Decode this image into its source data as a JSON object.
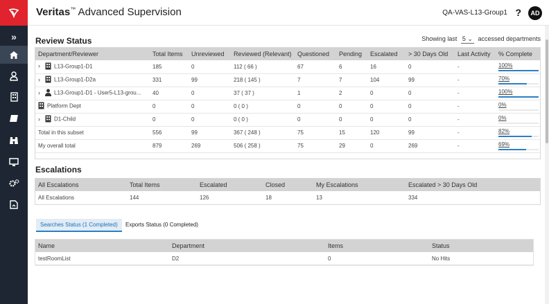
{
  "header": {
    "brand_bold": "Veritas",
    "brand_tm": "™",
    "brand_rest": " Advanced Supervision",
    "tenant": "QA-VAS-L13-Group1",
    "help": "?",
    "avatar": "AD"
  },
  "sidebar": {
    "logo_icon": "veritas-logo-icon",
    "items": [
      {
        "icon": "expand-icon",
        "glyph": "»"
      },
      {
        "icon": "home-icon",
        "active": true
      },
      {
        "icon": "user-icon"
      },
      {
        "icon": "building-icon"
      },
      {
        "icon": "tag-icon"
      },
      {
        "icon": "binoculars-icon"
      },
      {
        "icon": "monitor-icon"
      },
      {
        "icon": "settings-icon"
      },
      {
        "icon": "report-icon"
      }
    ]
  },
  "review": {
    "title": "Review Status",
    "showing_prefix": "Showing last",
    "showing_value": "5",
    "showing_suffix": "accessed departments",
    "columns": [
      "Department/Reviewer",
      "Total Items",
      "Unreviewed",
      "Reviewed (Relevant)",
      "Questioned",
      "Pending",
      "Escalated",
      "> 30 Days Old",
      "Last Activity",
      "% Complete"
    ],
    "rows": [
      {
        "name": "L13-Group1-D1",
        "expand": true,
        "icon": "building-icon",
        "total": "185",
        "unreviewed": "0",
        "reviewed": "112 ( 66 )",
        "questioned": "67",
        "pending": "6",
        "escalated": "16",
        "old": "0",
        "last": "-",
        "pct": "100%",
        "pct_value": 100
      },
      {
        "name": "L13-Group1-D2a",
        "expand": true,
        "icon": "building-icon",
        "total": "331",
        "unreviewed": "99",
        "reviewed": "218 ( 145 )",
        "questioned": "7",
        "pending": "7",
        "escalated": "104",
        "old": "99",
        "last": "-",
        "pct": "70%",
        "pct_value": 70
      },
      {
        "name": "L13-Group1-D1 - User5-L13-grou...",
        "expand": true,
        "icon": "user-icon",
        "total": "40",
        "unreviewed": "0",
        "reviewed": "37 ( 37 )",
        "questioned": "1",
        "pending": "2",
        "escalated": "0",
        "old": "0",
        "last": "-",
        "pct": "100%",
        "pct_value": 100
      },
      {
        "name": "Platform Dept",
        "expand": false,
        "icon": "building-icon",
        "total": "0",
        "unreviewed": "0",
        "reviewed": "0 ( 0 )",
        "questioned": "0",
        "pending": "0",
        "escalated": "0",
        "old": "0",
        "last": "-",
        "pct": "0%",
        "pct_value": 0
      },
      {
        "name": "D1-Child",
        "expand": true,
        "icon": "building-icon",
        "total": "0",
        "unreviewed": "0",
        "reviewed": "0 ( 0 )",
        "questioned": "0",
        "pending": "0",
        "escalated": "0",
        "old": "0",
        "last": "-",
        "pct": "0%",
        "pct_value": 0
      },
      {
        "name": "Total in this subset",
        "expand": false,
        "icon": "",
        "total": "556",
        "unreviewed": "99",
        "reviewed": "367 ( 248 )",
        "questioned": "75",
        "pending": "15",
        "escalated": "120",
        "old": "99",
        "last": "-",
        "pct": "82%",
        "pct_value": 82
      },
      {
        "name": "My overall total",
        "expand": false,
        "icon": "",
        "total": "879",
        "unreviewed": "269",
        "reviewed": "506 ( 258 )",
        "questioned": "75",
        "pending": "29",
        "escalated": "0",
        "old": "269",
        "last": "-",
        "pct": "69%",
        "pct_value": 69
      }
    ]
  },
  "escalations": {
    "title": "Escalations",
    "columns": [
      "All Escalations",
      "Total Items",
      "Escalated",
      "Closed",
      "My Escalations",
      "Escalated > 30 Days Old"
    ],
    "rows": [
      {
        "name": "All Escalations",
        "total": "144",
        "escalated": "126",
        "closed": "18",
        "mine": "13",
        "old": "334"
      }
    ]
  },
  "tabs": [
    {
      "label": "Searches Status (1 Completed)",
      "active": true
    },
    {
      "label": "Exports Status (0 Completed)",
      "active": false
    }
  ],
  "searches": {
    "columns": [
      "Name",
      "Department",
      "Items",
      "Status"
    ],
    "rows": [
      {
        "name": "testRoomList",
        "department": "D2",
        "items": "0",
        "status": "No Hits"
      }
    ]
  },
  "colors": {
    "accent": "#2a7fc4",
    "sidebar": "#1d2632",
    "logo": "#e0232d"
  }
}
